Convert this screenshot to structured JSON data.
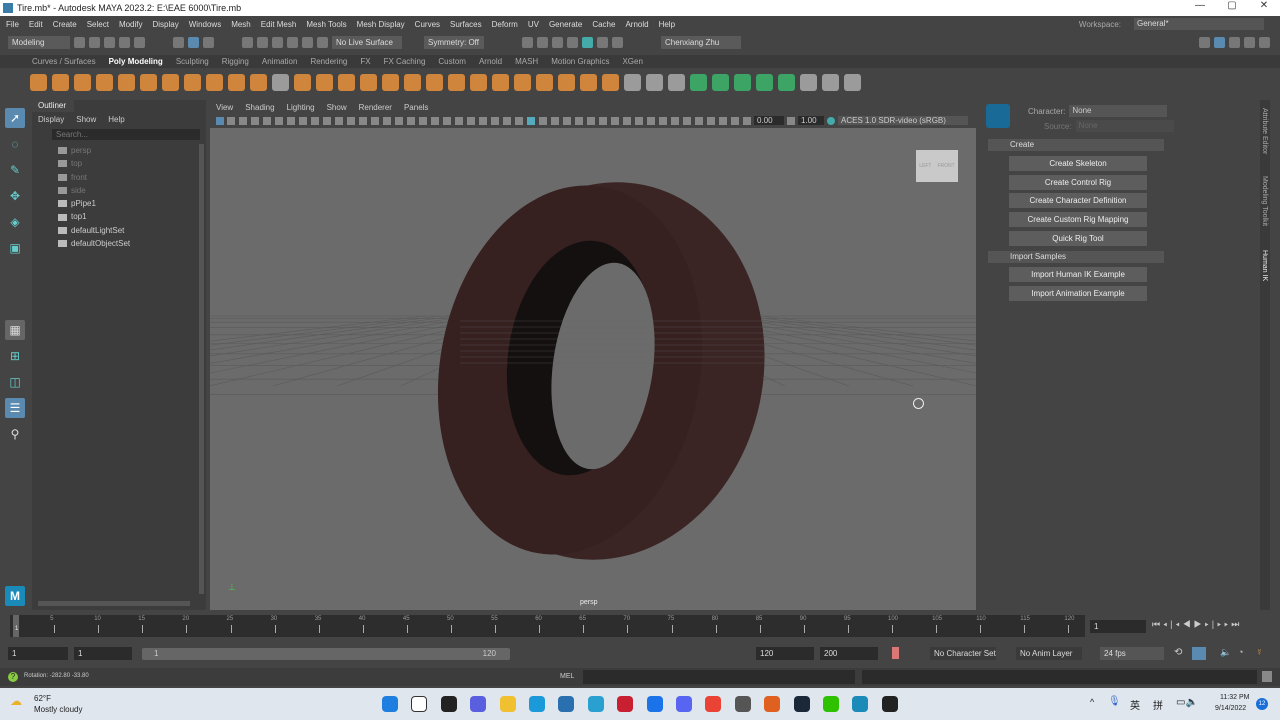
{
  "window": {
    "title": "Tire.mb* - Autodesk MAYA 2023.2: E:\\EAE 6000\\Tire.mb",
    "minimize": "—",
    "maximize": "▢",
    "close": "✕"
  },
  "menus": [
    "File",
    "Edit",
    "Create",
    "Select",
    "Modify",
    "Display",
    "Windows",
    "Mesh",
    "Edit Mesh",
    "Mesh Tools",
    "Mesh Display",
    "Curves",
    "Surfaces",
    "Deform",
    "UV",
    "Generate",
    "Cache",
    "Arnold",
    "Help"
  ],
  "workspace": {
    "label": "Workspace:",
    "value": "General*"
  },
  "statusline": {
    "mode": "Modeling",
    "live_surface": "No Live Surface",
    "symmetry": "Symmetry: Off",
    "user": "Chenxiang Zhu"
  },
  "shelf_tabs": [
    "Curves / Surfaces",
    "Poly Modeling",
    "Sculpting",
    "Rigging",
    "Animation",
    "Rendering",
    "FX",
    "FX Caching",
    "Custom",
    "Arnold",
    "MASH",
    "Motion Graphics",
    "XGen"
  ],
  "shelf_active": "Poly Modeling",
  "outliner": {
    "tab": "Outliner",
    "menus": [
      "Display",
      "Show",
      "Help"
    ],
    "search_placeholder": "Search...",
    "items": [
      {
        "name": "persp",
        "dim": true
      },
      {
        "name": "top",
        "dim": true
      },
      {
        "name": "front",
        "dim": true
      },
      {
        "name": "side",
        "dim": true
      },
      {
        "name": "pPipe1",
        "dim": false
      },
      {
        "name": "top1",
        "dim": false
      },
      {
        "name": "defaultLightSet",
        "dim": false
      },
      {
        "name": "defaultObjectSet",
        "dim": false
      }
    ]
  },
  "viewport": {
    "menus": [
      "View",
      "Shading",
      "Lighting",
      "Show",
      "Renderer",
      "Panels"
    ],
    "exposure": "0.00",
    "gamma": "1.00",
    "color_space": "ACES 1.0 SDR-video (sRGB)",
    "camera": "persp",
    "cube_left": "LEFT",
    "cube_front": "FRONT",
    "tire_color": "#3a2424"
  },
  "hik": {
    "character_label": "Character:",
    "character": "None",
    "source_label": "Source:",
    "source": "None",
    "create_section": "Create",
    "create_buttons": [
      "Create Skeleton",
      "Create Control Rig",
      "Create Character Definition",
      "Create Custom Rig Mapping",
      "Quick Rig Tool"
    ],
    "import_section": "Import Samples",
    "import_buttons": [
      "Import Human IK Example",
      "Import Animation Example"
    ],
    "side_tabs": [
      "Attribute Editor",
      "Modeling Toolkit",
      "Human IK"
    ]
  },
  "timeline": {
    "ticks": [
      "5",
      "10",
      "15",
      "20",
      "25",
      "30",
      "35",
      "40",
      "45",
      "50",
      "55",
      "60",
      "65",
      "70",
      "75",
      "80",
      "85",
      "90",
      "95",
      "100",
      "105",
      "110",
      "115",
      "120"
    ],
    "current": "1",
    "current_field": "1"
  },
  "range": {
    "start": "1",
    "start2": "1",
    "slider_start": "1",
    "slider_end": "120",
    "end": "120",
    "end2": "200",
    "char_set": "No Character Set",
    "anim_layer": "No Anim Layer",
    "fps": "24 fps"
  },
  "commandline": {
    "feedback": "Rotation:  -282.80    -33.80",
    "lang": "MEL"
  },
  "taskbar": {
    "temp": "62°F",
    "weather": "Mostly cloudy",
    "ime1": "英",
    "ime2": "拼",
    "time": "11:32 PM",
    "date": "9/14/2022",
    "notif": "12"
  }
}
